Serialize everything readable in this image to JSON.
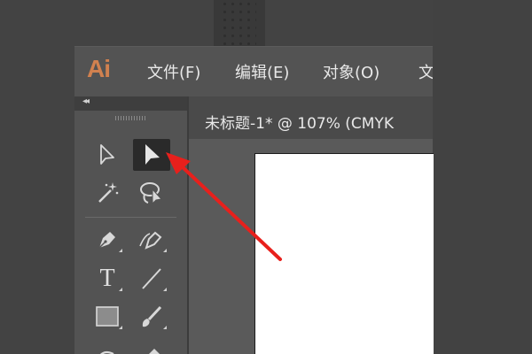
{
  "app": {
    "logo_text": "Ai",
    "logo_color": "#d1814f"
  },
  "menubar": {
    "items": [
      {
        "label": "文件(F)"
      },
      {
        "label": "编辑(E)"
      },
      {
        "label": "对象(O)"
      },
      {
        "label": "文"
      }
    ]
  },
  "document": {
    "tab_title": "未标题-1* @ 107% (CMYK"
  },
  "toolbar": {
    "collapse_glyph": "◂◂",
    "tools": [
      {
        "name": "direct-selection-tool",
        "icon": "hollow-arrow-icon",
        "active": false
      },
      {
        "name": "selection-tool",
        "icon": "solid-arrow-icon",
        "active": true
      },
      {
        "name": "magic-wand-tool",
        "icon": "magic-wand-icon",
        "active": false
      },
      {
        "name": "lasso-tool",
        "icon": "lasso-icon",
        "active": false
      },
      {
        "name": "pen-tool",
        "icon": "pen-nib-icon",
        "active": false
      },
      {
        "name": "curvature-tool",
        "icon": "curvature-pen-icon",
        "active": false
      },
      {
        "name": "type-tool",
        "icon": "type-icon",
        "active": false
      },
      {
        "name": "line-segment-tool",
        "icon": "line-icon",
        "active": false
      },
      {
        "name": "rectangle-tool",
        "icon": "rectangle-icon",
        "active": false
      },
      {
        "name": "paintbrush-tool",
        "icon": "paintbrush-icon",
        "active": false
      },
      {
        "name": "shaper-tool",
        "icon": "shaper-icon",
        "active": false
      },
      {
        "name": "eraser-tool",
        "icon": "eraser-icon",
        "active": false
      }
    ],
    "type_glyph": "T"
  },
  "annotation": {
    "arrow_color": "#e8201c"
  }
}
